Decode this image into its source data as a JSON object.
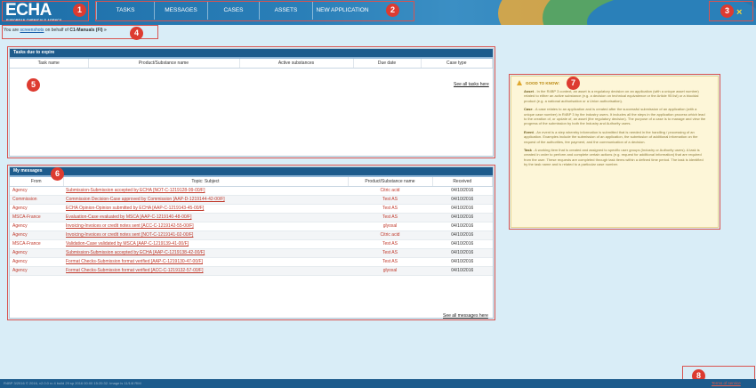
{
  "brand": {
    "logo_text": "ECHA",
    "agency_name": "EUROPEAN CHEMICALS AGENCY"
  },
  "nav": {
    "items": [
      {
        "label": "TASKS"
      },
      {
        "label": "MESSAGES"
      },
      {
        "label": "CASES"
      },
      {
        "label": "ASSETS"
      },
      {
        "label": "NEW APPLICATION"
      }
    ]
  },
  "header": {
    "close_icon": "×"
  },
  "userbar": {
    "prefix": "You are",
    "user": "screenshots",
    "middle": "on behalf of",
    "org": "C1-Manuals (FI)",
    "arrow": "»"
  },
  "tasks": {
    "title": "Tasks due to expire",
    "columns": [
      "Task name",
      "Product/Substance name",
      "Active substances",
      "Due date",
      "Case type"
    ],
    "see_all": "See all tasks here"
  },
  "messages": {
    "title": "My messages",
    "columns": [
      "From",
      "Topic: Subject",
      "Product/Substance name",
      "Received"
    ],
    "rows": [
      {
        "from": "Agency",
        "subject": "Submission-Submission accepted by ECHA [NOT-C-1219128-99-00/F]",
        "product": "Citric acid",
        "received": "04/10/2016"
      },
      {
        "from": "Commission",
        "subject": "Commission Decision-Case approved by Commission [AAP-D-1219144-42-00/F]",
        "product": "Test AS",
        "received": "04/10/2016"
      },
      {
        "from": "Agency",
        "subject": "ECHA Opinion-Opinion submitted by ECHA [AAP-C-1219143-45-00/F]",
        "product": "Test AS",
        "received": "04/10/2016"
      },
      {
        "from": "MSCA-France",
        "subject": "Evaluation-Case evaluated by MSCA [AAP-C-1219140-48-00/F]",
        "product": "Test AS",
        "received": "04/10/2016"
      },
      {
        "from": "Agency",
        "subject": "Invoicing-Invoices or credit notes sent [ACC-C-1219142-55-00/F]",
        "product": "glyoxal",
        "received": "04/10/2016"
      },
      {
        "from": "Agency",
        "subject": "Invoicing-Invoices or credit notes sent [NOT-C-1219141-02-00/F]",
        "product": "Citric acid",
        "received": "04/10/2016"
      },
      {
        "from": "MSCA-France",
        "subject": "Validation-Case validated by MSCA [AAP-C-1219139-41-00/F]",
        "product": "Test AS",
        "received": "04/10/2016"
      },
      {
        "from": "Agency",
        "subject": "Submission-Submission accepted by ECHA [AAP-C-1219138-42-00/F]",
        "product": "Test AS",
        "received": "04/10/2016"
      },
      {
        "from": "Agency",
        "subject": "Format Checks-Submission format verified [AAP-C-1219130-47-00/F]",
        "product": "Test AS",
        "received": "04/10/2016"
      },
      {
        "from": "Agency",
        "subject": "Format Checks-Submission format verified [ACC-C-1219132-57-00/F]",
        "product": "glyoxal",
        "received": "04/10/2016"
      }
    ],
    "see_all": "See all messages here"
  },
  "good_to_know": {
    "title": "GOOD TO KNOW:",
    "items": [
      {
        "term": "Asset",
        "text": " - In the R4BP 3 context, an asset is a regulatory decision on an application (with a unique asset number) related to either an active substance (e.g. a decision on technical equivalence or the Article 95 list) or a biocidal product (e.g. a national authorisation or a Union authorisation)."
      },
      {
        "term": "Case",
        "text": " - A case relates to an application and is created after the successful submission of an application (with a unique case number) in R4BP 3 by the industry users. It includes all the steps in the application process which lead to the creation of, or update of, an asset (the regulatory decision). The purpose of a case is to manage and view the progress of the submission by both the Industry and Authority users."
      },
      {
        "term": "Event",
        "text": " - An event is a step whereby information is submitted that is needed in the handling / processing of an application. Examples include the submission of an application, the submission of additional information on the request of the authorities, fee payment, and the communication of a decision."
      },
      {
        "term": "Task",
        "text": " - A working item that is created and assigned to specific user groups (Industry or Authority users). A task is created in order to perform and complete certain actions (e.g. request for additional information) that are required from the user. These requests are completed through task items within a defined time period. The task is identified by the task name and is related to a particular case number."
      }
    ]
  },
  "footer": {
    "text": "R4BP 3/2016 © 2016, v2.0.0 rc 4 build 29 sp 2016 00:00 15:20:32. Image is 11/1/8 RIM",
    "link": "Terms of service"
  },
  "annotations": [
    "1",
    "2",
    "3",
    "4",
    "5",
    "6",
    "7",
    "8"
  ],
  "colors": {
    "header": "#2a7fb8",
    "panel_title": "#1d5b8c",
    "page_bg": "#d9edf7",
    "annotation_red": "#dd3b30",
    "link_red": "#c0392b"
  }
}
